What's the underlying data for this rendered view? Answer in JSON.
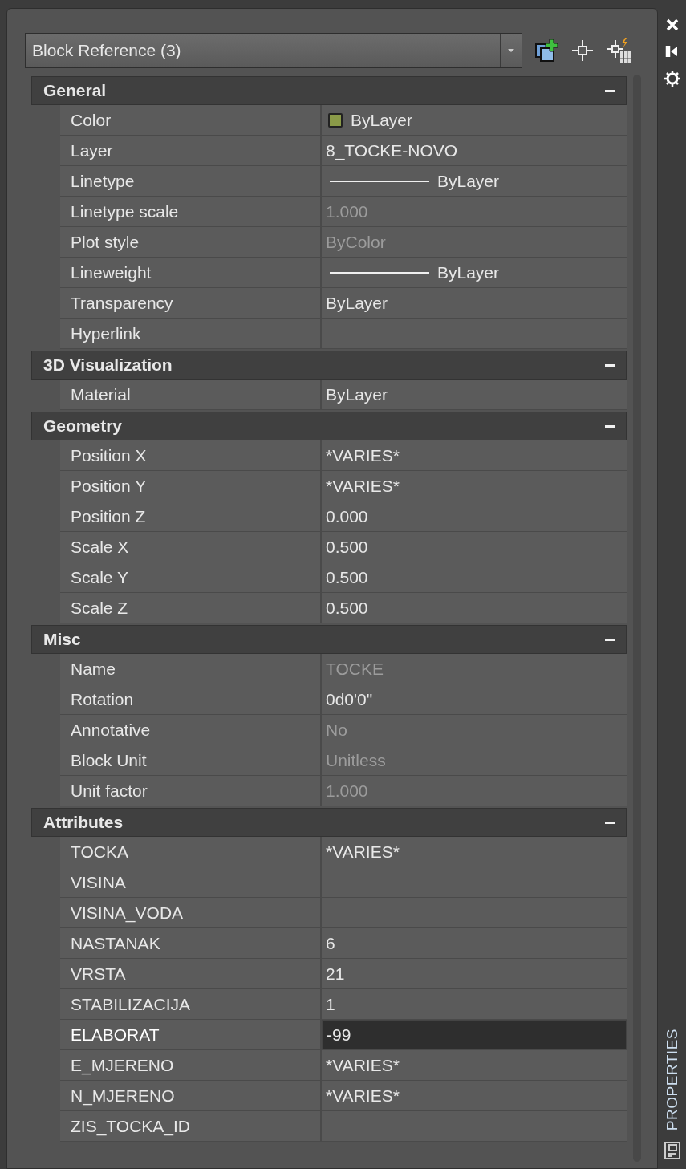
{
  "selector": {
    "value": "Block Reference (3)"
  },
  "sections": [
    {
      "title": "General",
      "expanded": true,
      "rows": [
        {
          "label": "Color",
          "value": "ByLayer",
          "kind": "color",
          "color": "#8a9a48",
          "disabled": false,
          "editing": false
        },
        {
          "label": "Layer",
          "value": "8_TOCKE-NOVO",
          "kind": "text",
          "disabled": false,
          "editing": false
        },
        {
          "label": "Linetype",
          "value": "ByLayer",
          "kind": "line",
          "disabled": false,
          "editing": false
        },
        {
          "label": "Linetype scale",
          "value": "1.000",
          "kind": "text",
          "disabled": true,
          "editing": false
        },
        {
          "label": "Plot style",
          "value": "ByColor",
          "kind": "text",
          "disabled": true,
          "editing": false
        },
        {
          "label": "Lineweight",
          "value": "ByLayer",
          "kind": "line",
          "disabled": false,
          "editing": false
        },
        {
          "label": "Transparency",
          "value": "ByLayer",
          "kind": "text",
          "disabled": false,
          "editing": false
        },
        {
          "label": "Hyperlink",
          "kind": "text",
          "disabled": false,
          "editing": false
        }
      ]
    },
    {
      "title": "3D Visualization",
      "expanded": true,
      "rows": [
        {
          "label": "Material",
          "value": "ByLayer",
          "kind": "text",
          "disabled": false,
          "editing": false
        }
      ]
    },
    {
      "title": "Geometry",
      "expanded": true,
      "rows": [
        {
          "label": "Position X",
          "value": "*VARIES*",
          "kind": "text",
          "disabled": false,
          "editing": false
        },
        {
          "label": "Position Y",
          "value": "*VARIES*",
          "kind": "text",
          "disabled": false,
          "editing": false
        },
        {
          "label": "Position Z",
          "value": "0.000",
          "kind": "text",
          "disabled": false,
          "editing": false
        },
        {
          "label": "Scale X",
          "value": "0.500",
          "kind": "text",
          "disabled": false,
          "editing": false
        },
        {
          "label": "Scale Y",
          "value": "0.500",
          "kind": "text",
          "disabled": false,
          "editing": false
        },
        {
          "label": "Scale Z",
          "value": "0.500",
          "kind": "text",
          "disabled": false,
          "editing": false
        }
      ]
    },
    {
      "title": "Misc",
      "expanded": true,
      "rows": [
        {
          "label": "Name",
          "value": "TOCKE",
          "kind": "text",
          "disabled": true,
          "editing": false
        },
        {
          "label": "Rotation",
          "value": "0d0'0\"",
          "kind": "text",
          "disabled": false,
          "editing": false
        },
        {
          "label": "Annotative",
          "value": "No",
          "kind": "text",
          "disabled": true,
          "editing": false
        },
        {
          "label": "Block Unit",
          "value": "Unitless",
          "kind": "text",
          "disabled": true,
          "editing": false
        },
        {
          "label": "Unit factor",
          "value": "1.000",
          "kind": "text",
          "disabled": true,
          "editing": false
        }
      ]
    },
    {
      "title": "Attributes",
      "expanded": true,
      "rows": [
        {
          "label": "TOCKA",
          "value": "*VARIES*",
          "kind": "text",
          "disabled": false,
          "editing": false
        },
        {
          "label": "VISINA",
          "kind": "text",
          "disabled": false,
          "editing": false
        },
        {
          "label": "VISINA_VODA",
          "kind": "text",
          "disabled": false,
          "editing": false
        },
        {
          "label": "NASTANAK",
          "value": "6",
          "kind": "text",
          "disabled": false,
          "editing": false
        },
        {
          "label": "VRSTA",
          "value": "21",
          "kind": "text",
          "disabled": false,
          "editing": false
        },
        {
          "label": "STABILIZACIJA",
          "value": "1",
          "kind": "text",
          "disabled": false,
          "editing": false
        },
        {
          "label": "ELABORAT",
          "value": "-99",
          "kind": "text",
          "disabled": false,
          "editing": true
        },
        {
          "label": "E_MJERENO",
          "value": "*VARIES*",
          "kind": "text",
          "disabled": false,
          "editing": false
        },
        {
          "label": "N_MJERENO",
          "value": "*VARIES*",
          "kind": "text",
          "disabled": false,
          "editing": false
        },
        {
          "label": "ZIS_TOCKA_ID",
          "kind": "text",
          "disabled": false,
          "editing": false
        }
      ]
    }
  ],
  "side_title": "PROPERTIES"
}
